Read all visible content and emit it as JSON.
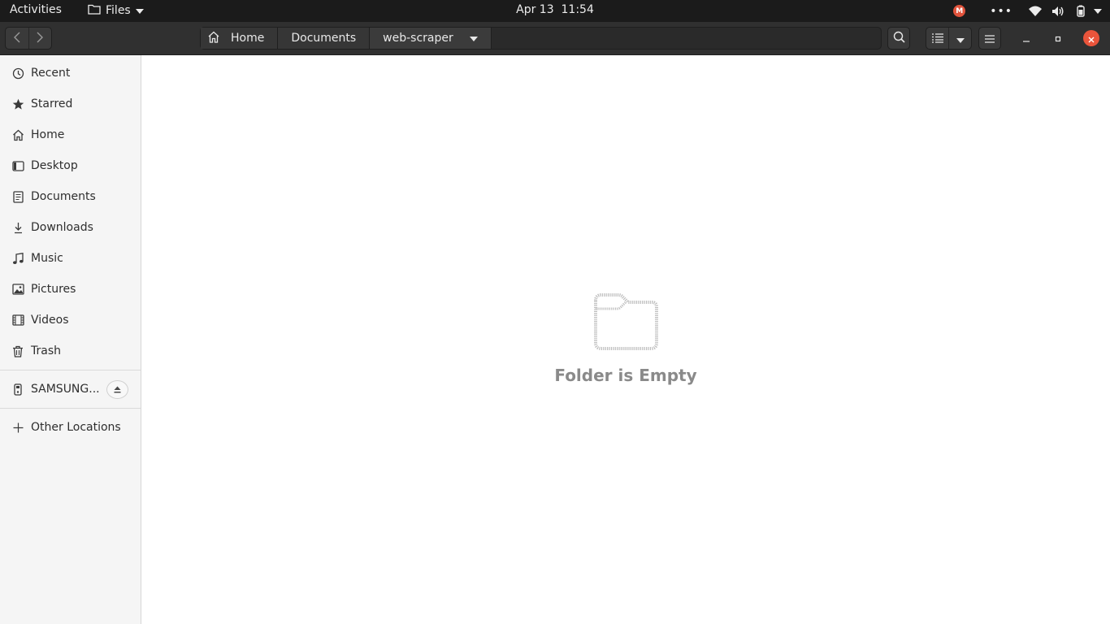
{
  "topbar": {
    "activities": "Activities",
    "app_name": "Files",
    "date": "Apr 13",
    "time": "11:54",
    "tray": [
      "mega-icon",
      "more-dots-icon",
      "wifi-icon",
      "volume-icon",
      "battery-icon",
      "chevron-down-icon"
    ],
    "mega_letter": "M",
    "dots": "•••"
  },
  "pathbar": {
    "crumbs": [
      "Home",
      "Documents",
      "web-scraper"
    ]
  },
  "sidebar": {
    "items": [
      {
        "label": "Recent",
        "icon": "clock-icon"
      },
      {
        "label": "Starred",
        "icon": "star-icon"
      },
      {
        "label": "Home",
        "icon": "home-icon"
      },
      {
        "label": "Desktop",
        "icon": "desktop-icon"
      },
      {
        "label": "Documents",
        "icon": "document-icon"
      },
      {
        "label": "Downloads",
        "icon": "download-icon"
      },
      {
        "label": "Music",
        "icon": "music-icon"
      },
      {
        "label": "Pictures",
        "icon": "picture-icon"
      },
      {
        "label": "Videos",
        "icon": "video-icon"
      },
      {
        "label": "Trash",
        "icon": "trash-icon"
      }
    ],
    "device": {
      "label": "SAMSUNG...",
      "icon": "drive-icon"
    },
    "other": {
      "label": "Other Locations",
      "icon": "plus-icon"
    }
  },
  "main": {
    "empty_message": "Folder is Empty"
  },
  "colors": {
    "topbar_bg": "#1b1b1b",
    "headerbar_bg": "#303030",
    "sidebar_bg": "#f5f5f5",
    "close_button": "#e9543b",
    "empty_text": "#8a8a8a"
  }
}
